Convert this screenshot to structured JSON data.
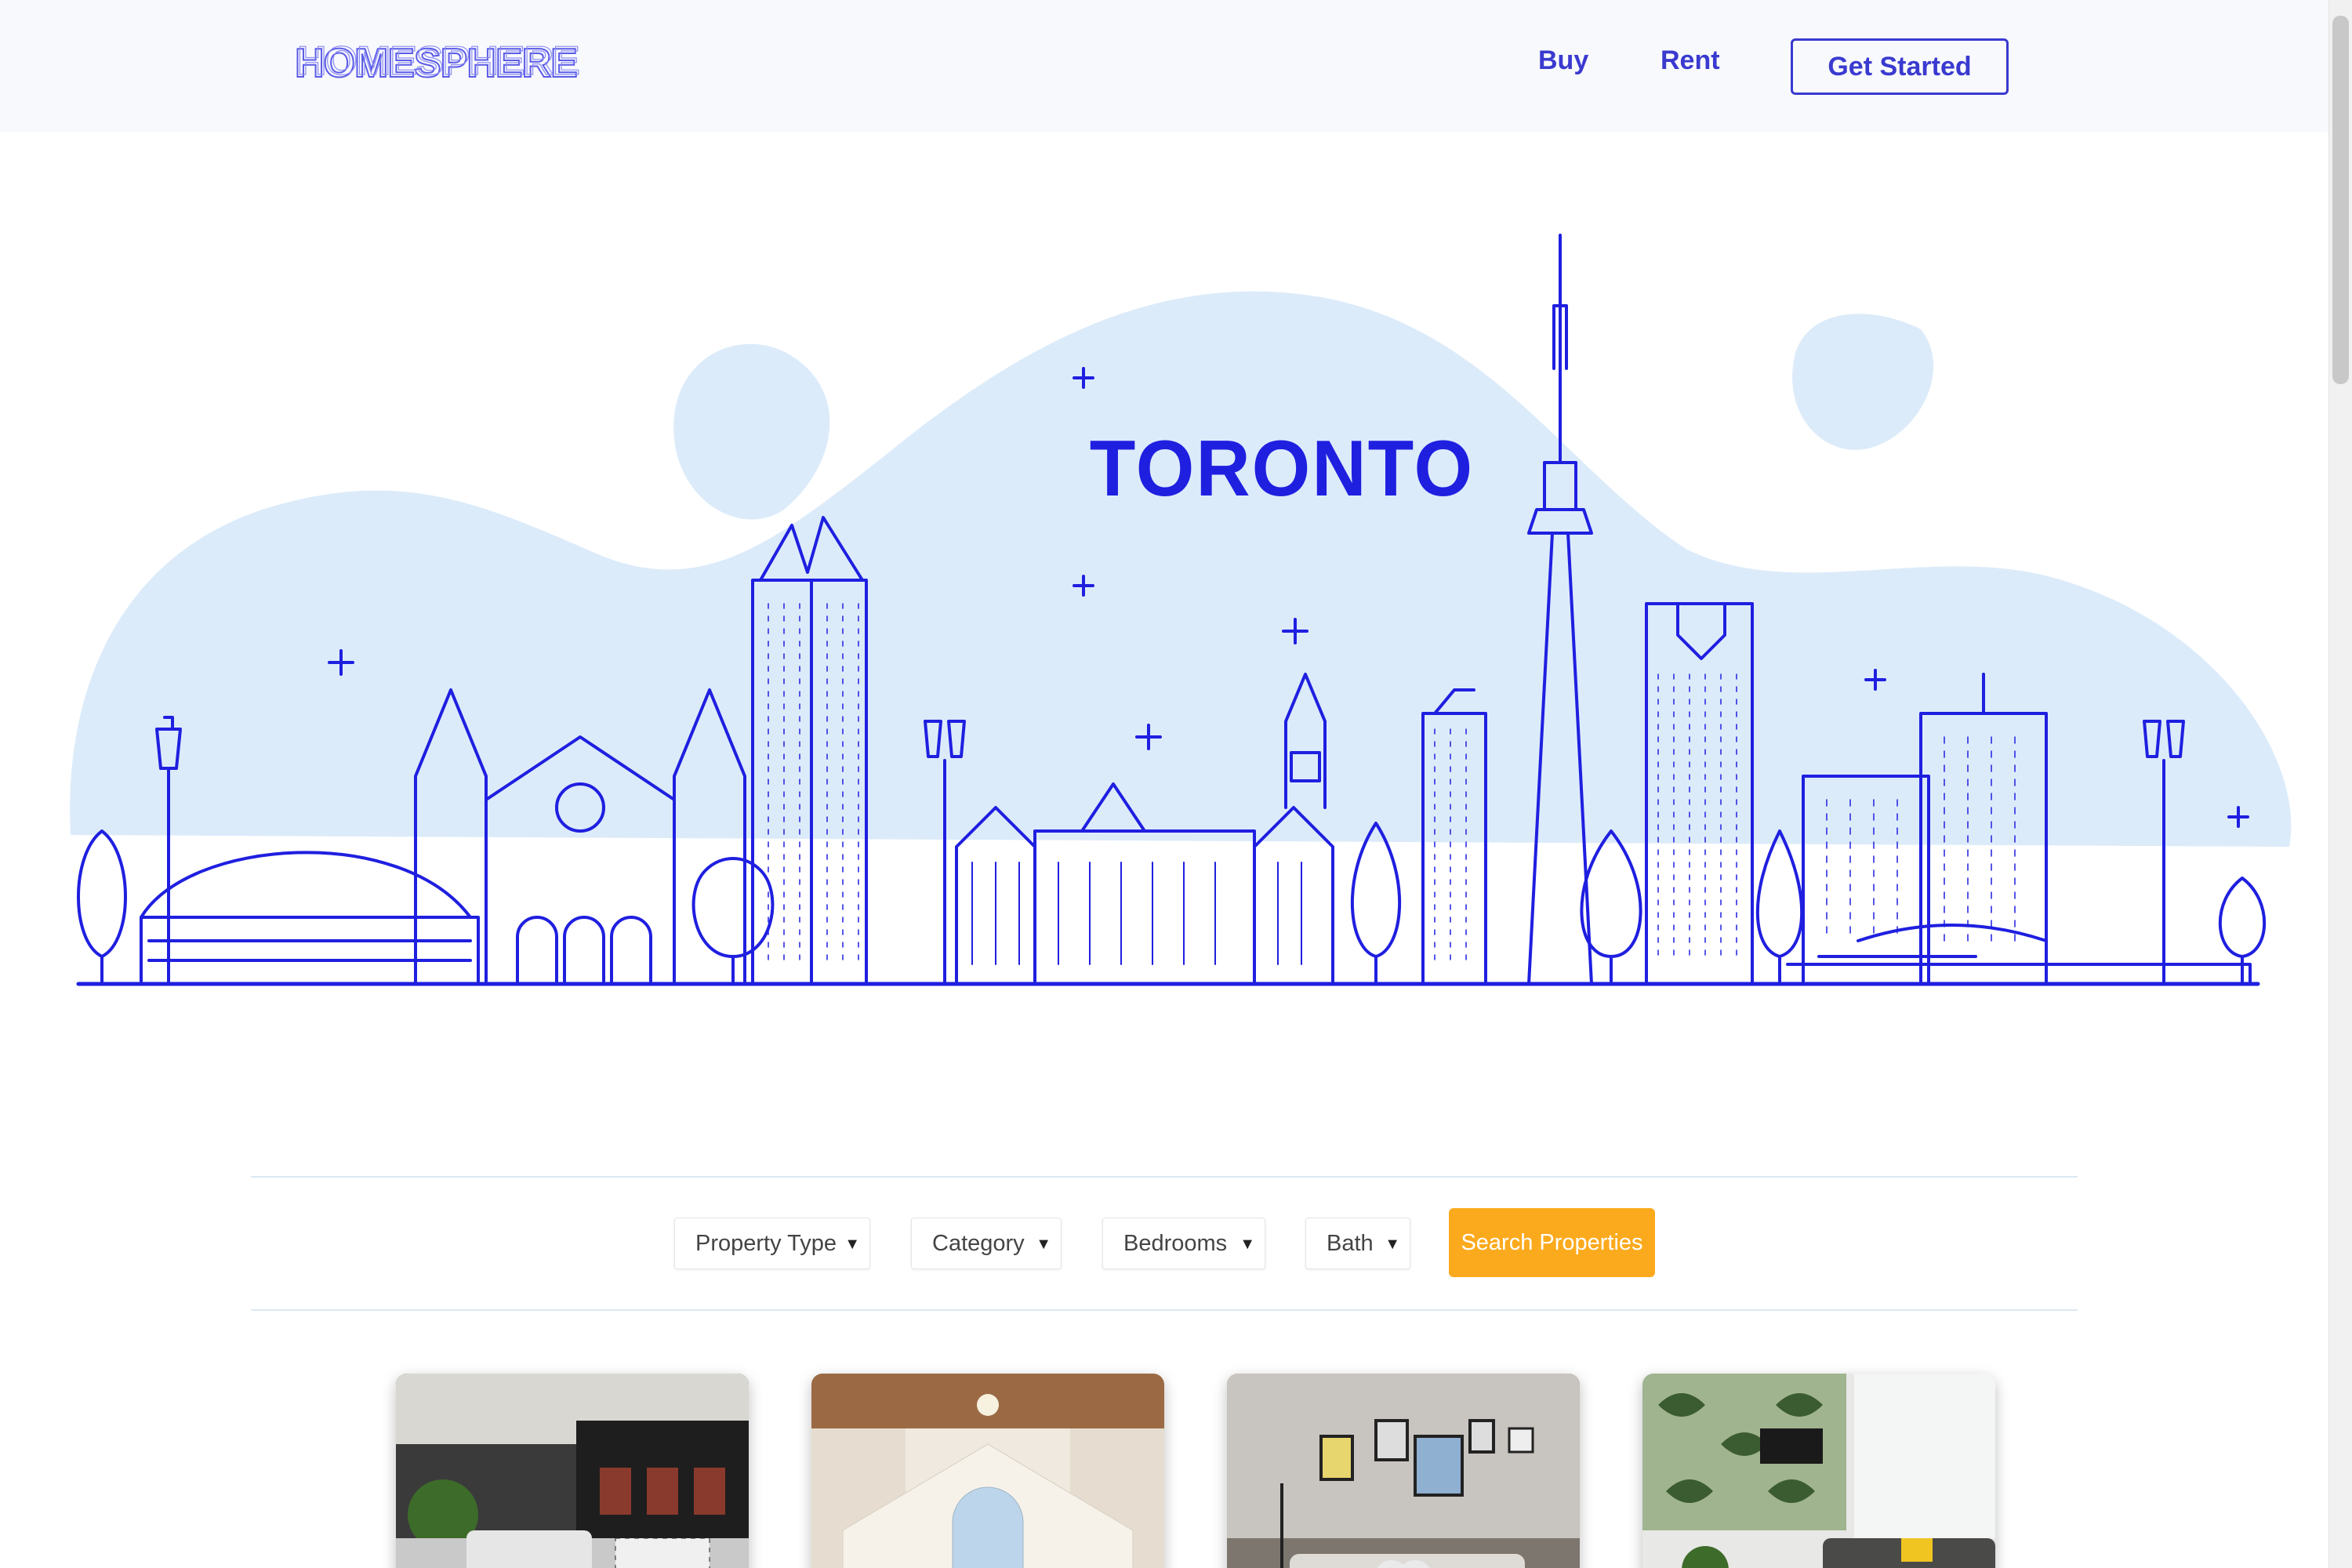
{
  "header": {
    "logo_text": "HOMESPHERE",
    "nav": {
      "buy": "Buy",
      "rent": "Rent"
    },
    "cta": "Get Started"
  },
  "hero": {
    "city_title": "TORONTO"
  },
  "filters": {
    "property_type": "Property Type",
    "category": "Category",
    "bedrooms": "Bedrooms",
    "bath": "Bath",
    "search_button": "Search Properties"
  },
  "listings": [
    {
      "image": "living-room-dark-interior"
    },
    {
      "image": "attic-bedroom-wood-ceiling"
    },
    {
      "image": "living-room-gallery-wall"
    },
    {
      "image": "living-room-leaf-wallpaper"
    }
  ],
  "colors": {
    "brand": "#3a3ad0",
    "accent": "#fcaa1d",
    "hero_blob": "#dcebfa",
    "skyline_stroke": "#1f1fe0"
  }
}
